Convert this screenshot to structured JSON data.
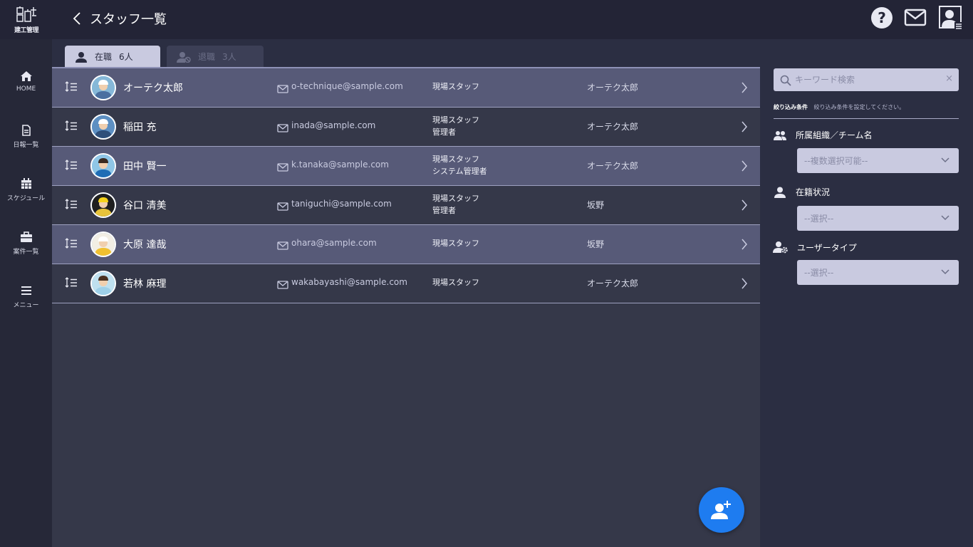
{
  "app": {
    "logo_text": "建工管理"
  },
  "header": {
    "title": "スタッフ一覧"
  },
  "sidebar": {
    "items": [
      {
        "label": "HOME",
        "icon": "home-icon"
      },
      {
        "label": "日報一覧",
        "icon": "document-icon"
      },
      {
        "label": "スケジュール",
        "icon": "calendar-icon"
      },
      {
        "label": "案件一覧",
        "icon": "briefcase-icon"
      },
      {
        "label": "メニュー",
        "icon": "menu-icon"
      }
    ]
  },
  "tabs": [
    {
      "label": "在職",
      "count": "6人",
      "active": true
    },
    {
      "label": "退職",
      "count": "3人",
      "active": false
    }
  ],
  "staff": [
    {
      "name": "オーテク太郎",
      "email": "o-technique@sample.com",
      "role1": "現場スタッフ",
      "role2": "",
      "org": "オーテク太郎"
    },
    {
      "name": "稲田 充",
      "email": "inada@sample.com",
      "role1": "現場スタッフ",
      "role2": "管理者",
      "org": "オーテク太郎"
    },
    {
      "name": "田中 賢一",
      "email": "k.tanaka@sample.com",
      "role1": "現場スタッフ",
      "role2": "システム管理者",
      "org": "オーテク太郎"
    },
    {
      "name": "谷口 清美",
      "email": "taniguchi@sample.com",
      "role1": "現場スタッフ",
      "role2": "管理者",
      "org": "坂野"
    },
    {
      "name": "大原 達哉",
      "email": "ohara@sample.com",
      "role1": "現場スタッフ",
      "role2": "",
      "org": "坂野"
    },
    {
      "name": "若林 麻理",
      "email": "wakabayashi@sample.com",
      "role1": "現場スタッフ",
      "role2": "",
      "org": "オーテク太郎"
    }
  ],
  "filters": {
    "search_placeholder": "キーワード検索",
    "clear": "×",
    "condition_label": "絞り込み条件",
    "condition_hint": "絞り込み条件を設定してください。",
    "org": {
      "label": "所属組織／チーム名",
      "placeholder": "--複数選択可能--"
    },
    "status": {
      "label": "在籍状況",
      "placeholder": "--選択--"
    },
    "usertype": {
      "label": "ユーザータイプ",
      "placeholder": "--選択--"
    }
  },
  "colors": {
    "accent": "#1e7cf0",
    "row_highlight": "#575a78",
    "background": "#2b2e42"
  }
}
